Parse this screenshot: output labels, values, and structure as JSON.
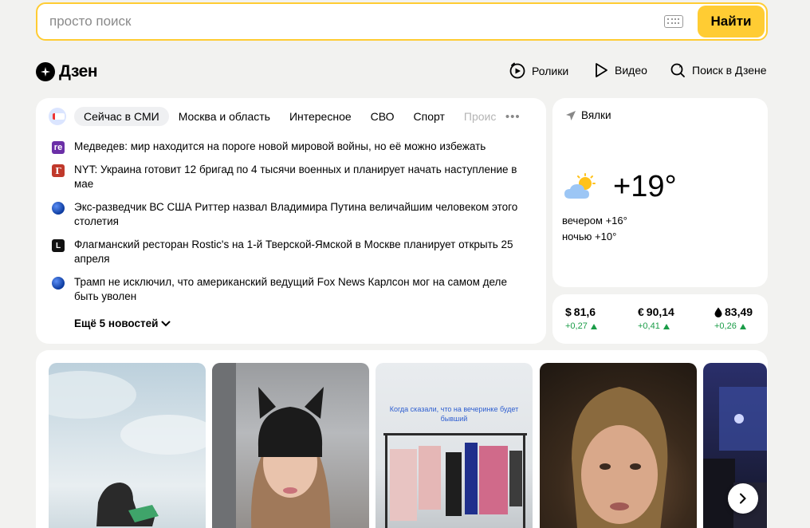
{
  "search": {
    "placeholder": "просто поиск",
    "value": "",
    "button_label": "Найти",
    "keyboard_icon": "keyboard-icon"
  },
  "header": {
    "logo_text": "Дзен",
    "nav": [
      {
        "label": "Ролики",
        "icon": "clips-icon"
      },
      {
        "label": "Видео",
        "icon": "play-icon"
      },
      {
        "label": "Поиск в Дзене",
        "icon": "search-icon"
      }
    ]
  },
  "news": {
    "tabs": [
      "Сейчас в СМИ",
      "Москва и область",
      "Интересное",
      "СВО",
      "Спорт",
      "Проис"
    ],
    "active_tab": "Сейчас в СМИ",
    "items": [
      {
        "source": "re",
        "text": "Медведев: мир находится на пороге новой мировой войны, но её можно избежать"
      },
      {
        "source": "Г",
        "text": "NYT: Украина готовит 12 бригад по 4 тысячи военных и планирует начать наступление в мае"
      },
      {
        "source": "",
        "text": "Экс-разведчик ВС США Риттер назвал Владимира Путина величайшим человеком этого столетия"
      },
      {
        "source": "L",
        "text": "Флагманский ресторан Rostic's на 1-й Тверской-Ямской в Москве планирует открыть 25 апреля"
      },
      {
        "source": "",
        "text": "Трамп не исключил, что американский ведущий Fox News Карлсон мог на самом деле быть уволен"
      }
    ],
    "more_label": "Ещё 5 новостей"
  },
  "weather": {
    "location": "Вялки",
    "temperature": "+19°",
    "evening": "вечером +16°",
    "night": "ночью +10°",
    "icon": "partly-cloudy-icon"
  },
  "rates": [
    {
      "symbol": "$",
      "value": "81,6",
      "change": "+0,27"
    },
    {
      "symbol": "€",
      "value": "90,14",
      "change": "+0,41"
    },
    {
      "symbol": "",
      "value": "83,49",
      "change": "+0,26",
      "icon": "oil-drop-icon"
    }
  ],
  "colors": {
    "accent": "#ffcc33",
    "positive": "#1a9c47",
    "background": "#f2f2f0"
  },
  "videos": [
    {
      "caption": ""
    },
    {
      "caption": ""
    },
    {
      "caption": "Когда сказали, что на вечеринке будет бывший"
    },
    {
      "caption": ""
    },
    {
      "caption": ""
    }
  ]
}
